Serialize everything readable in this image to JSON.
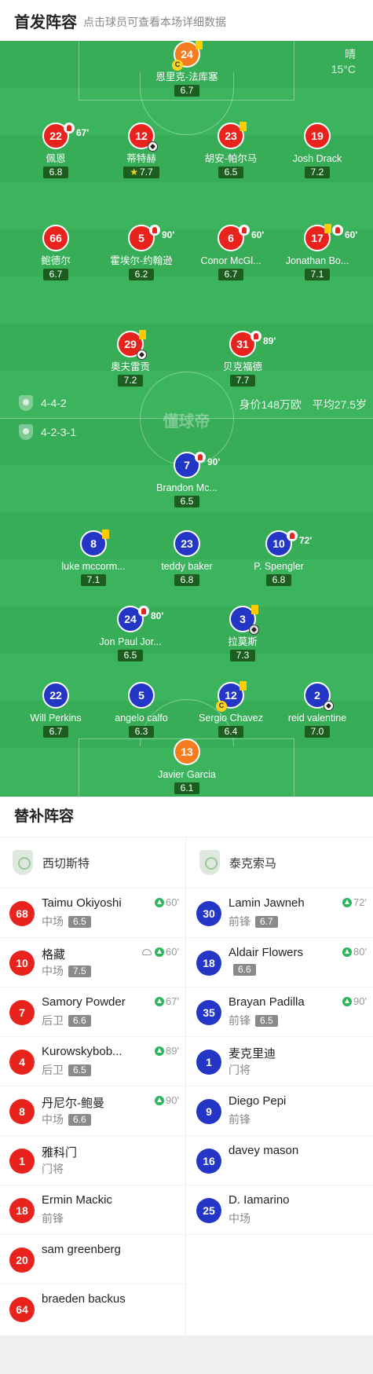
{
  "header": {
    "title": "首发阵容",
    "subtitle": "点击球员可查看本场详细数据"
  },
  "weather": {
    "condition": "晴",
    "temp": "15°C"
  },
  "watermark": "懂球帝",
  "home_team": {
    "formation": "4-4-2",
    "value": "身价148万欧",
    "avg_age": "平均27.5岁"
  },
  "away_team": {
    "formation": "4-2-3-1"
  },
  "home_players": [
    {
      "num": "24",
      "name": "恩里克-法库塞",
      "rating": "6.7",
      "color": "orange"
    },
    {
      "num": "22",
      "name": "佩恩",
      "rating": "6.8",
      "sub_time": "67'"
    },
    {
      "num": "12",
      "name": "蒂特赫",
      "rating": "7.7"
    },
    {
      "num": "23",
      "name": "胡安-帕尔马",
      "rating": "6.5"
    },
    {
      "num": "19",
      "name": "Josh Drack",
      "rating": "7.2"
    },
    {
      "num": "66",
      "name": "鲍德尔",
      "rating": "6.7"
    },
    {
      "num": "5",
      "name": "霍埃尔-约翰逊",
      "rating": "6.2",
      "sub_time": "90'"
    },
    {
      "num": "6",
      "name": "Conor McGl...",
      "rating": "6.7",
      "sub_time": "60'"
    },
    {
      "num": "17",
      "name": "Jonathan Bo...",
      "rating": "7.1",
      "sub_time": "60'"
    },
    {
      "num": "29",
      "name": "奥夫雷贡",
      "rating": "7.2"
    },
    {
      "num": "31",
      "name": "贝克福德",
      "rating": "7.7",
      "sub_time": "89'"
    }
  ],
  "away_players": [
    {
      "num": "7",
      "name": "Brandon Mc...",
      "rating": "6.5",
      "sub_time": "90'"
    },
    {
      "num": "8",
      "name": "luke mccorm...",
      "rating": "7.1"
    },
    {
      "num": "23",
      "name": "teddy baker",
      "rating": "6.8"
    },
    {
      "num": "10",
      "name": "P. Spengler",
      "rating": "6.8",
      "sub_time": "72'"
    },
    {
      "num": "24",
      "name": "Jon Paul Jor...",
      "rating": "6.5",
      "sub_time": "80'"
    },
    {
      "num": "3",
      "name": "拉莫斯",
      "rating": "7.3"
    },
    {
      "num": "22",
      "name": "Will Perkins",
      "rating": "6.7"
    },
    {
      "num": "5",
      "name": "angelo calfo",
      "rating": "6.3"
    },
    {
      "num": "12",
      "name": "Sergio Chavez",
      "rating": "6.4"
    },
    {
      "num": "2",
      "name": "reid valentine",
      "rating": "7.0"
    },
    {
      "num": "13",
      "name": "Javier Garcia",
      "rating": "6.1",
      "color": "orange"
    }
  ],
  "subs": {
    "title": "替补阵容",
    "home": {
      "team": "西切斯特",
      "players": [
        {
          "num": "68",
          "name": "Taimu Okiyoshi",
          "pos": "中场",
          "rating": "6.5",
          "in": "60'"
        },
        {
          "num": "10",
          "name": "格藏",
          "pos": "中场",
          "rating": "7.5",
          "in": "60'"
        },
        {
          "num": "7",
          "name": "Samory Powder",
          "pos": "后卫",
          "rating": "6.6",
          "in": "67'"
        },
        {
          "num": "4",
          "name": "Kurowskybob...",
          "pos": "后卫",
          "rating": "6.5",
          "in": "89'"
        },
        {
          "num": "8",
          "name": "丹尼尔-鲍曼",
          "pos": "中场",
          "rating": "6.6",
          "in": "90'"
        },
        {
          "num": "1",
          "name": "雅科门",
          "pos": "门将"
        },
        {
          "num": "18",
          "name": "Ermin Mackic",
          "pos": "前锋"
        },
        {
          "num": "20",
          "name": "sam greenberg",
          "pos": ""
        },
        {
          "num": "64",
          "name": "braeden backus",
          "pos": ""
        }
      ]
    },
    "away": {
      "team": "泰克索马",
      "players": [
        {
          "num": "30",
          "name": "Lamin Jawneh",
          "pos": "前锋",
          "rating": "6.7",
          "in": "72'"
        },
        {
          "num": "18",
          "name": "Aldair Flowers",
          "pos": "",
          "rating": "6.6",
          "in": "80'"
        },
        {
          "num": "35",
          "name": "Brayan Padilla",
          "pos": "前锋",
          "rating": "6.5",
          "in": "90'"
        },
        {
          "num": "1",
          "name": "麦克里迪",
          "pos": "门将"
        },
        {
          "num": "9",
          "name": "Diego Pepi",
          "pos": "前锋"
        },
        {
          "num": "16",
          "name": "davey mason",
          "pos": ""
        },
        {
          "num": "25",
          "name": "D. Iamarino",
          "pos": "中场"
        }
      ]
    }
  },
  "colors": {
    "pitch": "#37ad58",
    "home": "#e8221c",
    "away": "#2336c6",
    "keeper": "#f57c1f",
    "rating_bg": "#1b5e20"
  }
}
